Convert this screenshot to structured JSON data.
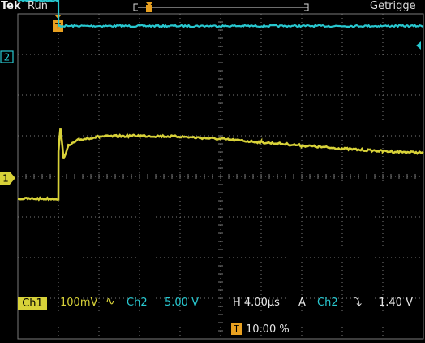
{
  "header": {
    "brand": "Tek",
    "run_state": "Run",
    "trigger_status": "Getrigge"
  },
  "markers": {
    "ch2_marker": "2",
    "ch1_marker": "1",
    "trigger_marker": "T"
  },
  "readout": {
    "ch1_label": "Ch1",
    "ch1_scale": "100mV",
    "ch1_coupling_symbol": "∿",
    "ch2_label": "Ch2",
    "ch2_scale": "5.00 V",
    "horizontal_scale": "H 4.00µs",
    "trigger_mode": "A",
    "trigger_source": "Ch2",
    "trigger_slope_symbol": "⤵",
    "trigger_level": "1.40 V",
    "trigger_position_icon": "T",
    "trigger_position": "10.00 %"
  },
  "colors": {
    "background": "#000000",
    "grid": "#7a7a7a",
    "ch1": "#d8d239",
    "ch2": "#28c8d0",
    "trigger": "#e8a020",
    "text": "#dcdcdc"
  },
  "chart_data": {
    "type": "line",
    "title": "",
    "xlabel": "",
    "ylabel": "",
    "x_unit": "µs",
    "x_per_division": 4.0,
    "x_divisions": 10,
    "trigger_position_percent": 10.0,
    "grid": true,
    "series": [
      {
        "name": "Ch1",
        "volts_per_division": 0.1,
        "x_us": [
          -4.0,
          0.0,
          0.01,
          0.2,
          0.5,
          1.0,
          2.0,
          4.0,
          8.0,
          12.0,
          16.0,
          20.0,
          24.0,
          28.0,
          32.0,
          36.0
        ],
        "y_div": [
          -0.55,
          -0.55,
          0.6,
          1.2,
          0.45,
          0.75,
          0.9,
          0.98,
          1.0,
          0.98,
          0.92,
          0.84,
          0.76,
          0.68,
          0.62,
          0.58
        ]
      },
      {
        "name": "Ch2",
        "volts_per_division": 5.0,
        "x_us": [
          -4.0,
          0.0,
          0.01,
          36.0
        ],
        "y_div": [
          4.33,
          4.33,
          3.7,
          3.7
        ]
      }
    ]
  }
}
